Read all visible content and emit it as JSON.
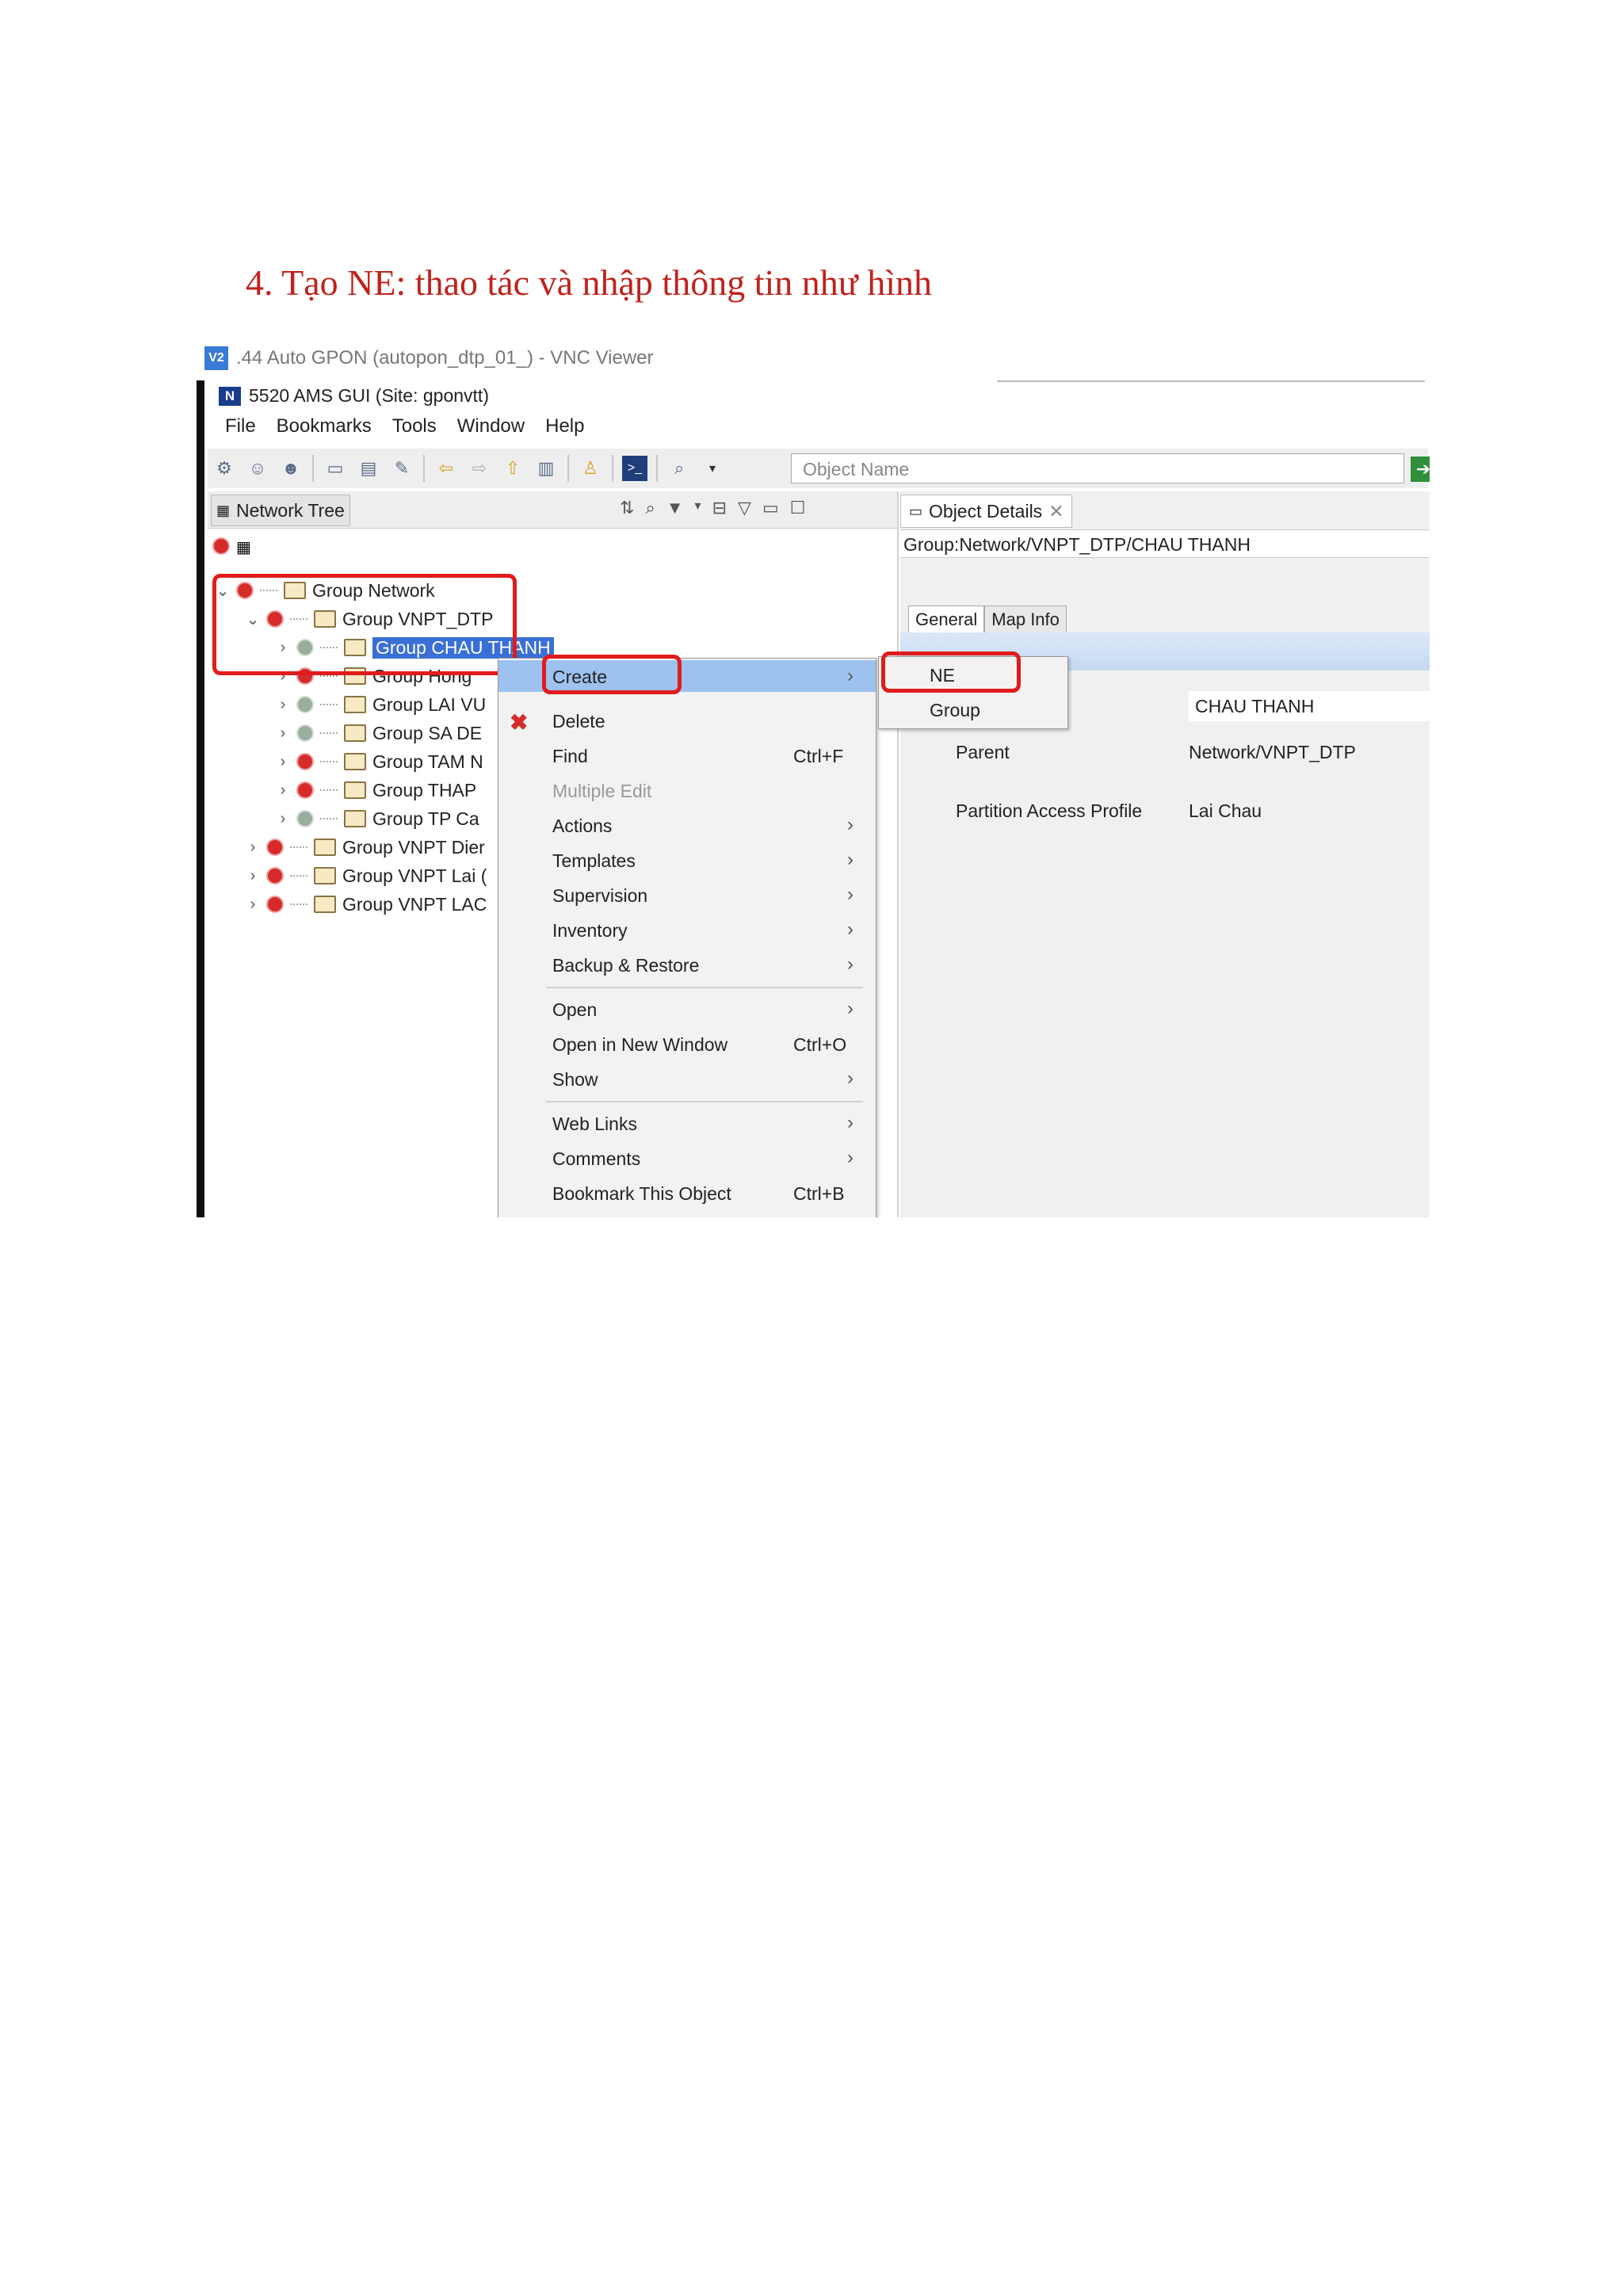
{
  "heading": "4.  Tạo NE: thao tác và nhập thông tin như hình",
  "vnc": {
    "logo": "V2",
    "title": ".44 Auto GPON (autopon_dtp_01_) - VNC Viewer"
  },
  "app": {
    "logo": "N",
    "title": "5520 AMS GUI (Site: gponvtt)"
  },
  "menubar": [
    "File",
    "Bookmarks",
    "Tools",
    "Window",
    "Help"
  ],
  "toolbar": {
    "search_placeholder": "Object Name"
  },
  "network_tree": {
    "tab_label": "Network Tree",
    "rows": [
      {
        "label": "Group Network",
        "status": "red",
        "expanded": true
      },
      {
        "label": "Group VNPT_DTP",
        "status": "red",
        "expanded": true
      },
      {
        "label": "Group CHAU THANH",
        "status": "gray",
        "selected": true
      },
      {
        "label": "Group Hong",
        "status": "red"
      },
      {
        "label": "Group LAI VU",
        "status": "gray"
      },
      {
        "label": "Group SA DE",
        "status": "gray"
      },
      {
        "label": "Group TAM N",
        "status": "red"
      },
      {
        "label": "Group THAP",
        "status": "red"
      },
      {
        "label": "Group TP Ca",
        "status": "gray"
      },
      {
        "label": "Group VNPT Dier",
        "status": "red"
      },
      {
        "label": "Group VNPT Lai (",
        "status": "red"
      },
      {
        "label": "Group VNPT LAC",
        "status": "red"
      }
    ]
  },
  "context_menu": {
    "items": [
      {
        "label": "Create",
        "arrow": true,
        "highlighted": true
      },
      {
        "label": "Delete",
        "icon": "delete-icon"
      },
      {
        "label": "Find",
        "shortcut": "Ctrl+F"
      },
      {
        "label": "Multiple Edit",
        "disabled": true
      },
      {
        "label": "Actions",
        "arrow": true
      },
      {
        "label": "Templates",
        "arrow": true
      },
      {
        "label": "Supervision",
        "arrow": true
      },
      {
        "label": "Inventory",
        "arrow": true
      },
      {
        "label": "Backup & Restore",
        "arrow": true
      },
      {
        "label": "Open",
        "arrow": true
      },
      {
        "label": "Open in New Window",
        "shortcut": "Ctrl+O"
      },
      {
        "label": "Show",
        "arrow": true
      },
      {
        "label": "Web Links",
        "arrow": true
      },
      {
        "label": "Comments",
        "arrow": true
      },
      {
        "label": "Bookmark This Object",
        "shortcut": "Ctrl+B"
      }
    ],
    "submenu": [
      "NE",
      "Group"
    ]
  },
  "object_details": {
    "tab_label": "Object Details",
    "path": "Group:Network/VNPT_DTP/CHAU THANH",
    "tabs": [
      "General",
      "Map Info"
    ],
    "name_value": "CHAU THANH",
    "parent_label": "Parent",
    "parent_value": "Network/VNPT_DTP",
    "pap_label": "Partition Access Profile",
    "pap_value": "Lai Chau"
  },
  "colors": {
    "annotation": "#e01c1c",
    "heading": "#c0221c",
    "selection": "#3a6fd6",
    "menu_highlight": "#9ec2ef"
  }
}
